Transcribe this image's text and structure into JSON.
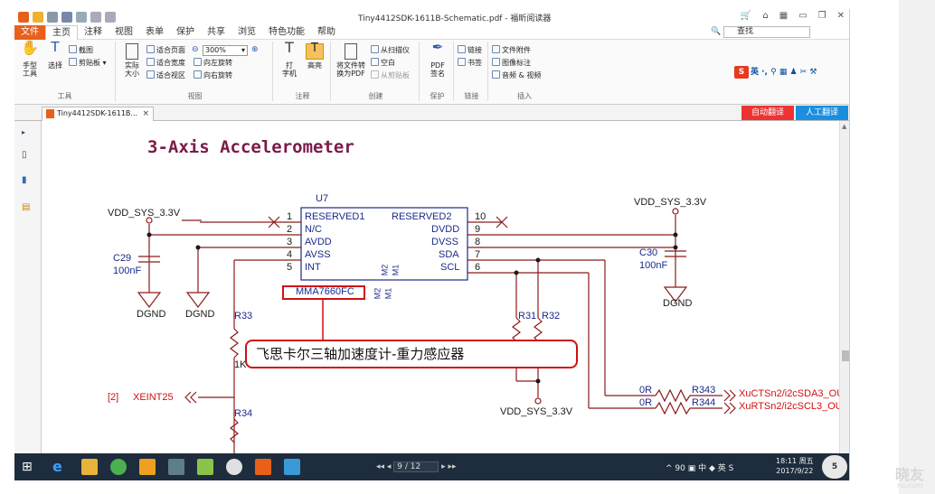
{
  "window": {
    "title": "Tiny4412SDK-1611B-Schematic.pdf - 福昕阅读器"
  },
  "menu": {
    "items": [
      "文件",
      "主页",
      "注释",
      "视图",
      "表单",
      "保护",
      "共享",
      "浏览",
      "特色功能",
      "帮助"
    ],
    "active": "主页",
    "search_placeholder": "查找"
  },
  "ribbon": {
    "tools_group": {
      "label": "工具",
      "hand": "手型\n工具",
      "select": "选择",
      "screenshot": "截图",
      "clipboard": "剪贴板"
    },
    "view_group": {
      "label": "视图",
      "actual_size": "实际\n大小",
      "fit_page": "适合页面",
      "fit_width": "适合宽度",
      "fit_visible": "适合视区",
      "zoom_value": "300%",
      "rotate_left": "向左旋转",
      "rotate_right": "向右旋转"
    },
    "annot_group": {
      "label": "注释",
      "typewriter": "打\n字机",
      "highlight": "高亮"
    },
    "create_group": {
      "label": "创建",
      "convert": "将文件转\n换为PDF",
      "from_scanner": "从扫描仪",
      "blank": "空白",
      "from_clipboard": "从剪贴板"
    },
    "protect_group": {
      "label": "保护",
      "sign": "PDF\n签名"
    },
    "link_group": {
      "label": "链接",
      "link": "链接",
      "bookmark": "书签"
    },
    "insert_group": {
      "label": "插入",
      "attachment": "文件附件",
      "image": "图像标注",
      "media": "音频 & 视频"
    }
  },
  "tab": {
    "doc_name": "Tiny4412SDK-1611B...",
    "close": "×",
    "auto_translate": "自动翻译",
    "human_translate": "人工翻译"
  },
  "schematic": {
    "heading": "3-Axis Accelerometer",
    "chip_ref": "U7",
    "chip_part": "MMA7660FC",
    "callout": "飞思卡尔三轴加速度计-重力感应器",
    "vdd_left": "VDD_SYS_3.3V",
    "vdd_right": "VDD_SYS_3.3V",
    "vdd_bottom": "VDD_SYS_3.3V",
    "c29": "C29",
    "c29_val": "100nF",
    "c30": "C30",
    "c30_val": "100nF",
    "dgnd": "DGND",
    "r33": "R33",
    "r34": "R34",
    "r31": "R31",
    "r32": "R32",
    "r343": "R343",
    "r344": "R344",
    "r_1k": "1K",
    "zero_r": "0R",
    "xeint_ref": "[2]",
    "xeint": "XEINT25",
    "out_sda": "XuCTSn2/i2cSDA3_OU",
    "out_scl": "XuRTSn2/i2cSCL3_OU",
    "m2": "M2",
    "m1": "M1",
    "left_pins": [
      {
        "num": "1",
        "name": "RESERVED1"
      },
      {
        "num": "2",
        "name": "N/C"
      },
      {
        "num": "3",
        "name": "AVDD"
      },
      {
        "num": "4",
        "name": "AVSS"
      },
      {
        "num": "5",
        "name": "INT"
      }
    ],
    "right_pins": [
      {
        "num": "10",
        "name": "RESERVED2"
      },
      {
        "num": "9",
        "name": "DVDD"
      },
      {
        "num": "8",
        "name": "DVSS"
      },
      {
        "num": "7",
        "name": "SDA"
      },
      {
        "num": "6",
        "name": "SCL"
      }
    ]
  },
  "taskbar": {
    "page_indicator": "9 / 12",
    "clock_time": "18:11 周五",
    "clock_date": "2017/9/22",
    "tray": "^ 90 ▣ 中 ◆ 英 S",
    "badge": "5"
  },
  "watermark": {
    "text": "晓友",
    "sub": "ns.com"
  }
}
